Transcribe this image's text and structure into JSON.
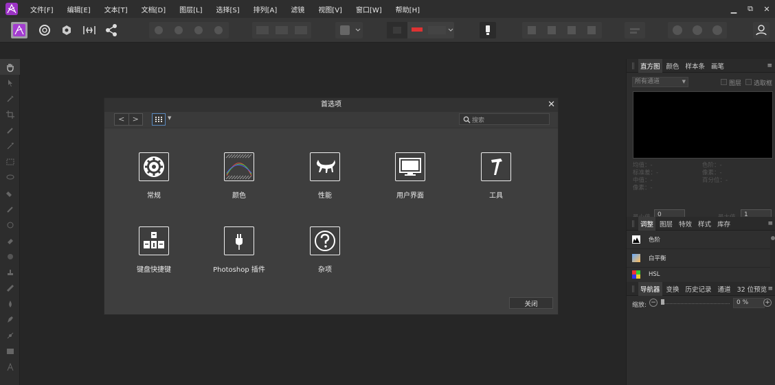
{
  "menubar": {
    "items": [
      "文件[F]",
      "编辑[E]",
      "文本[T]",
      "文档[D]",
      "图层[L]",
      "选择[S]",
      "排列[A]",
      "滤镜",
      "视图[V]",
      "窗口[W]",
      "帮助[H]"
    ],
    "window_controls": [
      "▁",
      "⧉",
      "✕"
    ]
  },
  "right_panel": {
    "top_tabs": [
      "直方图",
      "颜色",
      "样本条",
      "画笔"
    ],
    "channel_select": "所有通道",
    "checkbox_layer": "图层",
    "checkbox_selection": "选取框",
    "stats_left": [
      "均值：-",
      "标准差：-",
      "中值：-",
      "像素：-"
    ],
    "stats_right": [
      "色阶：-",
      "像素：-",
      "百分位：-"
    ],
    "min_label": "最小值",
    "min_value": "0",
    "max_label": "最大值",
    "max_value": "1",
    "adjust_tabs": [
      "调整",
      "图层",
      "特效",
      "样式",
      "库存"
    ],
    "adjust_items": [
      "色阶",
      "白平衡",
      "HSL"
    ],
    "nav_tabs": [
      "导航器",
      "变换",
      "历史记录",
      "通道",
      "32 位预览"
    ],
    "zoom_label": "缩放:",
    "zoom_value": "0 %"
  },
  "dialog": {
    "title": "首选项",
    "search_placeholder": "搜索",
    "categories": [
      "常规",
      "颜色",
      "性能",
      "用户界面",
      "工具",
      "键盘快捷键",
      "Photoshop 插件",
      "杂项"
    ],
    "close_button": "关闭"
  },
  "colors": {
    "accent": "#b03bd0",
    "menubar": "#2e2e2e",
    "toolbar": "#363636",
    "dialog": "#3e3e3e"
  }
}
